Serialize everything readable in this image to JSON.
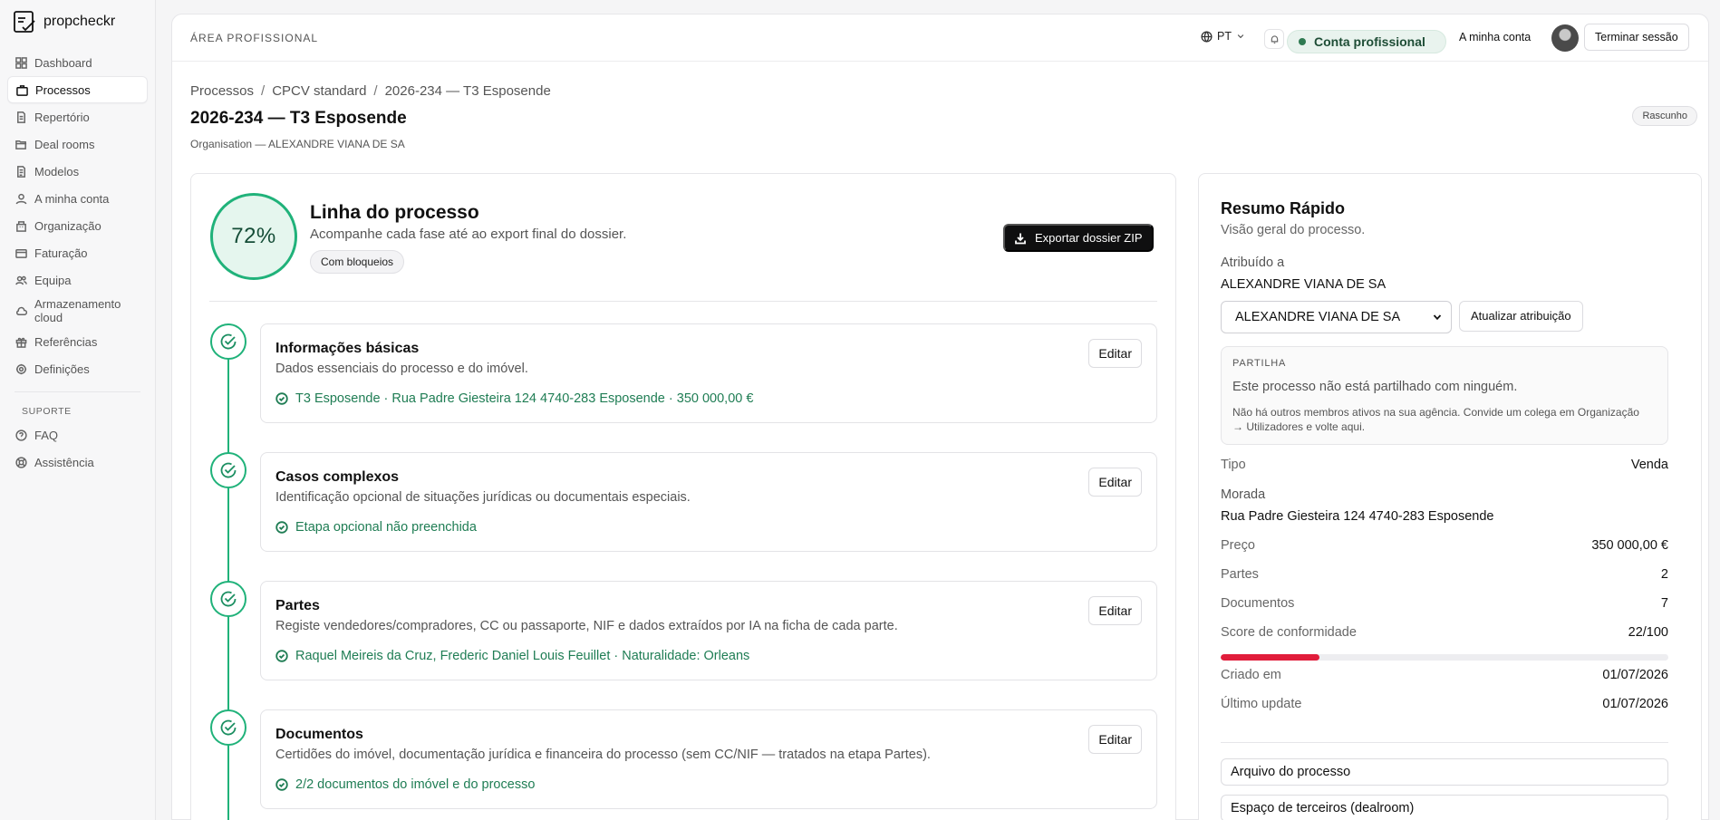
{
  "brand": {
    "name": "propcheckr"
  },
  "sidebar": {
    "items": [
      {
        "label": "Dashboard",
        "icon": "dashboard-icon"
      },
      {
        "label": "Processos",
        "icon": "briefcase-icon",
        "active": true
      },
      {
        "label": "Repertório",
        "icon": "document-icon"
      },
      {
        "label": "Deal rooms",
        "icon": "folder-open-icon"
      },
      {
        "label": "Modelos",
        "icon": "file-text-icon"
      },
      {
        "label": "A minha conta",
        "icon": "user-icon"
      },
      {
        "label": "Organização",
        "icon": "building-icon"
      },
      {
        "label": "Faturação",
        "icon": "credit-card-icon"
      },
      {
        "label": "Equipa",
        "icon": "users-icon"
      },
      {
        "label": "Armazenamento cloud",
        "icon": "cloud-icon"
      },
      {
        "label": "Referências",
        "icon": "gift-icon"
      },
      {
        "label": "Definições",
        "icon": "gear-icon"
      }
    ],
    "support_heading": "SUPORTE",
    "support_items": [
      {
        "label": "FAQ",
        "icon": "help-circle-icon"
      },
      {
        "label": "Assistência",
        "icon": "lifebuoy-icon"
      }
    ]
  },
  "topbar": {
    "area_label": "ÁREA PROFISSIONAL",
    "language": "PT",
    "pro_badge": "Conta profissional",
    "my_account": "A minha conta",
    "logout": "Terminar sessão"
  },
  "header": {
    "breadcrumb": [
      "Processos",
      "CPCV standard",
      "2026-234 — T3 Esposende"
    ],
    "breadcrumb_sep": "/",
    "title": "2026-234 — T3 Esposende",
    "organisation": "Organisation — ALEXANDRE VIANA DE SA",
    "status": "Rascunho"
  },
  "process": {
    "progress_label": "72%",
    "progress_value": 72,
    "title": "Linha do processo",
    "subtitle": "Acompanhe cada fase até ao export final do dossier.",
    "blocked_chip": "Com bloqueios",
    "export_button": "Exportar dossier ZIP",
    "steps": [
      {
        "title": "Informações básicas",
        "description": "Dados essenciais do processo e do imóvel.",
        "status": "T3 Esposende · Rua Padre Giesteira 124 4740-283 Esposende · 350 000,00 €",
        "edit": "Editar"
      },
      {
        "title": "Casos complexos",
        "description": "Identificação opcional de situações jurídicas ou documentais especiais.",
        "status": "Etapa opcional não preenchida",
        "edit": "Editar"
      },
      {
        "title": "Partes",
        "description": "Registe vendedores/compradores, CC ou passaporte, NIF e dados extraídos por IA na ficha de cada parte.",
        "status": "Raquel Meireis da Cruz, Frederic Daniel Louis Feuillet · Naturalidade: Orleans",
        "edit": "Editar"
      },
      {
        "title": "Documentos",
        "description": "Certidões do imóvel, documentação jurídica e financeira do processo (sem CC/NIF — tratados na etapa Partes).",
        "status": "2/2 documentos do imóvel e do processo",
        "edit": "Editar"
      }
    ]
  },
  "summary": {
    "title": "Resumo Rápido",
    "subtitle": "Visão geral do processo.",
    "assigned_label": "Atribuído a",
    "assigned_value": "ALEXANDRE VIANA DE SA",
    "assign_select_value": "ALEXANDRE VIANA DE SA",
    "assign_button": "Atualizar atribuição",
    "share": {
      "heading": "PARTILHA",
      "main": "Este processo não está partilhado com ninguém.",
      "note": "Não há outros membros ativos na sua agência. Convide um colega em Organização → Utilizadores e volte aqui."
    },
    "tipo_label": "Tipo",
    "tipo_value": "Venda",
    "morada_label": "Morada",
    "morada_value": "Rua Padre Giesteira 124 4740-283 Esposende",
    "preco_label": "Preço",
    "preco_value": "350 000,00 €",
    "partes_label": "Partes",
    "partes_value": "2",
    "documentos_label": "Documentos",
    "documentos_value": "7",
    "score_label": "Score de conformidade",
    "score_value": "22/100",
    "score_fraction": 0.22,
    "criado_label": "Criado em",
    "criado_value": "01/07/2026",
    "update_label": "Último update",
    "update_value": "01/07/2026",
    "links": [
      "Arquivo do processo",
      "Espaço de terceiros (dealroom)"
    ]
  },
  "colors": {
    "accent_green": "#20b27a",
    "status_green_text": "#1f7d54",
    "score_red": "#e11d3b",
    "primary_button": "#0f0f10"
  }
}
